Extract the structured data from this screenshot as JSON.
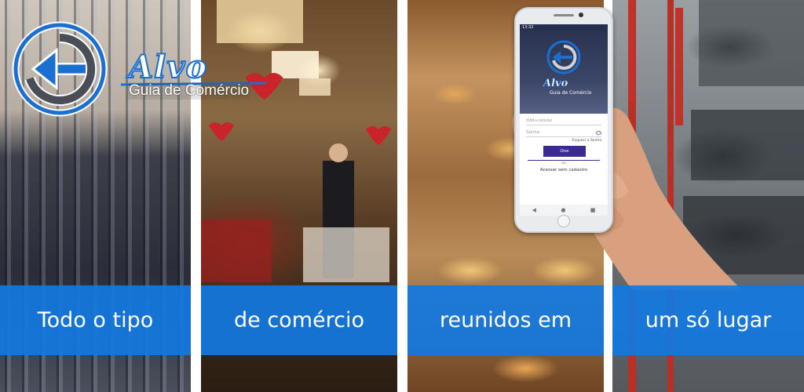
{
  "brand": {
    "name": "Alvo",
    "tagline": "Guia de Comércio",
    "primary_color": "#1a6fd1",
    "logo_icon": "return-arrow-circle-icon"
  },
  "panels": [
    {
      "scene": "clothing-store",
      "caption": "Todo o tipo"
    },
    {
      "scene": "restaurant",
      "caption": "de comércio"
    },
    {
      "scene": "bakery",
      "caption": "reunidos em"
    },
    {
      "scene": "auto-repair-shop",
      "caption": "um só lugar"
    }
  ],
  "band_color": "#1278e1",
  "phone": {
    "status_time": "13:32",
    "app_title": "Alvo",
    "app_subtitle": "Guia de Comércio",
    "phone_field_placeholder": "ddd+celular",
    "password_field_placeholder": "Senha",
    "forgot_password_link": "Esqueci a Senha",
    "primary_button_label": "One",
    "or_label": "ou",
    "guest_access_link": "Acessar sem cadastro",
    "nav_icons": [
      "back-icon",
      "home-circle-icon",
      "recent-apps-icon"
    ]
  }
}
